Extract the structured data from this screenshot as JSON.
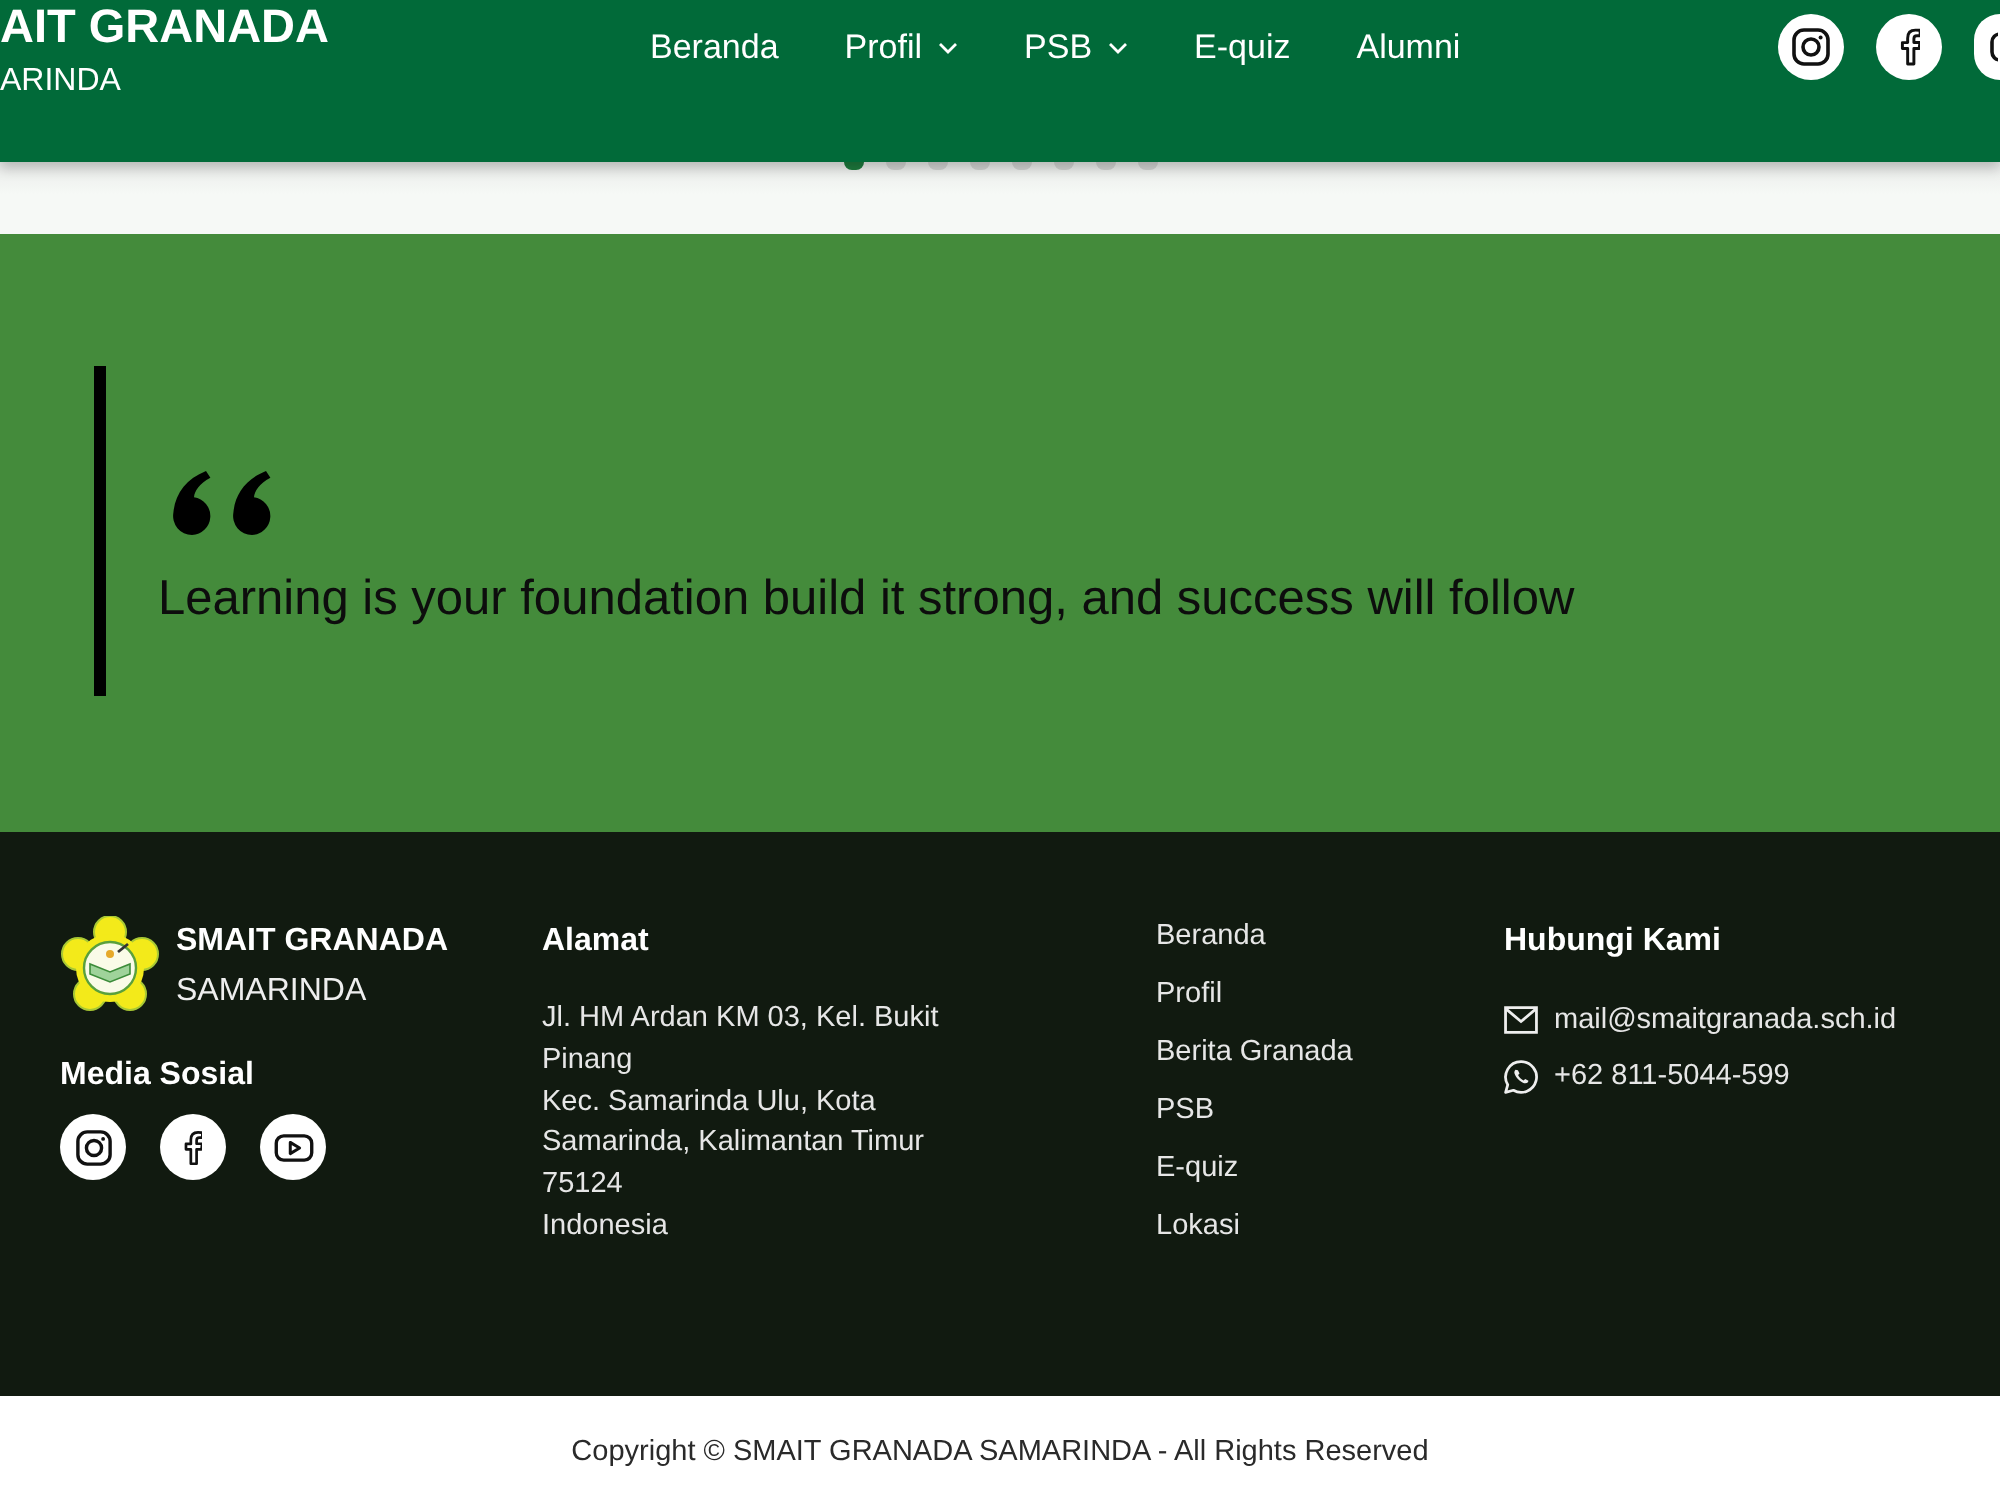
{
  "header": {
    "brand": {
      "title": "AIT GRANADA",
      "subtitle": "ARINDA"
    },
    "nav": [
      {
        "label": "Beranda",
        "dropdown": false
      },
      {
        "label": "Profil",
        "dropdown": true
      },
      {
        "label": "PSB",
        "dropdown": true
      },
      {
        "label": "E-quiz",
        "dropdown": false
      },
      {
        "label": "Alumni",
        "dropdown": false
      }
    ],
    "social": [
      {
        "kind": "instagram"
      },
      {
        "kind": "facebook"
      },
      {
        "kind": "youtube"
      }
    ]
  },
  "carousel_dots": [
    {
      "selected": true
    },
    {
      "selected": false
    },
    {
      "selected": false
    },
    {
      "selected": false
    },
    {
      "selected": false
    },
    {
      "selected": false
    },
    {
      "selected": false
    },
    {
      "selected": false
    }
  ],
  "quote": {
    "text": "Learning is your foundation build it strong, and success will follow"
  },
  "footer": {
    "brand": {
      "title": "SMAIT GRANADA",
      "subtitle": "SAMARINDA"
    },
    "social_title": "Media Sosial",
    "social": [
      {
        "kind": "instagram"
      },
      {
        "kind": "facebook"
      },
      {
        "kind": "youtube"
      }
    ],
    "address": {
      "title": "Alamat",
      "lines": [
        "Jl. HM Ardan KM 03, Kel. Bukit Pinang",
        "Kec. Samarinda Ulu, Kota Samarinda, Kalimantan Timur 75124",
        "Indonesia"
      ]
    },
    "links": [
      "Beranda",
      "Profil",
      "Berita Granada",
      "PSB",
      "E-quiz",
      "Lokasi"
    ],
    "contact": {
      "title": "Hubungi Kami",
      "items": [
        {
          "kind": "email",
          "text": "mail@smaitgranada.sch.id"
        },
        {
          "kind": "whatsapp",
          "text": "+62 811-5044-599"
        }
      ]
    }
  },
  "copyright": "Copyright © SMAIT GRANADA SAMARINDA - All Rights Reserved"
}
